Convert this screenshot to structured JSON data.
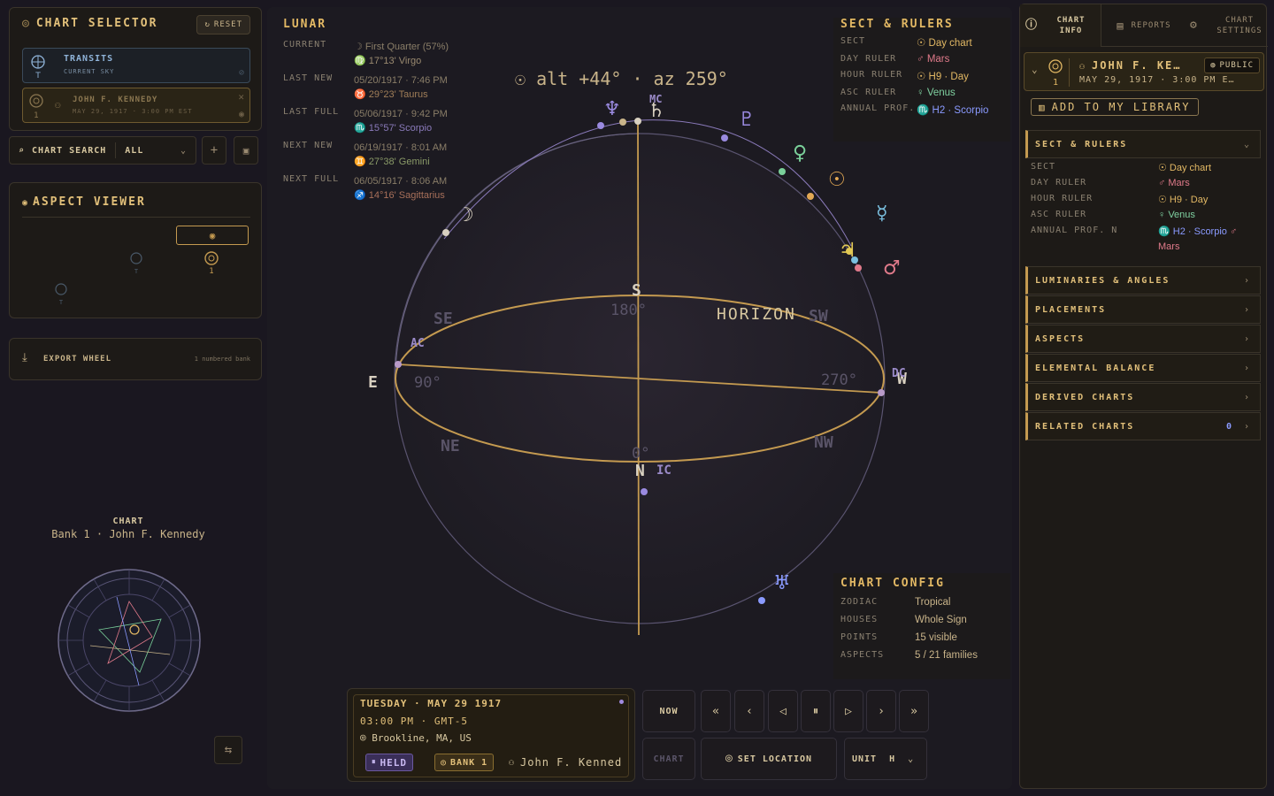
{
  "chart_selector": {
    "title": "CHART SELECTOR",
    "reset": "RESET",
    "transits": {
      "label": "TRANSITS",
      "sub": "CURRENT SKY"
    },
    "bank": {
      "number": "1",
      "label": "JOHN F. KENNEDY",
      "sub": "MAY 29, 1917 · 3:00 PM EST"
    }
  },
  "search": {
    "label": "CHART SEARCH",
    "filter": "ALL"
  },
  "aspect_viewer": {
    "title": "ASPECT VIEWER",
    "bank_number": "1"
  },
  "export": {
    "label": "EXPORT WHEEL",
    "sub": "1 numbered bank"
  },
  "chart_caption": {
    "title": "CHART",
    "subtitle": "Bank 1 · John F. Kennedy"
  },
  "lunar": {
    "title": "LUNAR",
    "rows": [
      {
        "key": "CURRENT",
        "line1": "First Quarter (57%)",
        "line2": "17°13' Virgo",
        "icon1": "☽",
        "icon2": "♍"
      },
      {
        "key": "LAST NEW",
        "line1": "05/20/1917 · 7:46 PM",
        "line2": "29°23' Taurus",
        "icon2": "♉"
      },
      {
        "key": "LAST FULL",
        "line1": "05/06/1917 · 9:42 PM",
        "line2": "15°57' Scorpio",
        "icon2": "♏"
      },
      {
        "key": "NEXT NEW",
        "line1": "06/19/1917 · 8:01 AM",
        "line2": "27°38' Gemini",
        "icon2": "♊"
      },
      {
        "key": "NEXT FULL",
        "line1": "06/05/1917 · 8:06 AM",
        "line2": "14°16' Sagittarius",
        "icon2": "♐"
      }
    ]
  },
  "sect": {
    "title": "SECT & RULERS",
    "rows": [
      {
        "key": "SECT",
        "value": "Day chart",
        "icon": "☉",
        "color": "#e2b864"
      },
      {
        "key": "DAY RULER",
        "value": "Mars",
        "icon": "♂",
        "color": "#e07a8a"
      },
      {
        "key": "HOUR RULER",
        "value": "H9 · Day",
        "icon": "☉",
        "color": "#e2b864"
      },
      {
        "key": "ASC RULER",
        "value": "Venus",
        "icon": "♀",
        "color": "#7fd0a0"
      },
      {
        "key": "ANNUAL PROF.",
        "value": "H2 · Scorpio",
        "icon": "♏",
        "color": "#8a9aff"
      }
    ]
  },
  "sky": {
    "readout": "☉ alt +44° · az 259°",
    "labels": {
      "horizon": "HORIZON",
      "s": "S",
      "n": "N",
      "e": "E",
      "w": "W",
      "se": "SE",
      "sw": "SW",
      "ne": "NE",
      "nw": "NW",
      "deg180": "180°",
      "deg90": "90°",
      "deg270": "270°",
      "deg0": "0°",
      "mc": "MC",
      "ic": "IC",
      "ac": "AC",
      "dc": "DC"
    }
  },
  "chart_config": {
    "title": "CHART CONFIG",
    "rows": [
      {
        "key": "ZODIAC",
        "value": "Tropical"
      },
      {
        "key": "HOUSES",
        "value": "Whole Sign"
      },
      {
        "key": "POINTS",
        "value": "15 visible"
      },
      {
        "key": "ASPECTS",
        "value": "5 / 21 families"
      }
    ]
  },
  "datetime": {
    "day": "TUESDAY · MAY 29 1917",
    "time": "03:00 PM · GMT-5",
    "location": "Brookline, MA, US",
    "held": "HELD",
    "bank": "BANK 1",
    "person": "John F. Kenned"
  },
  "controls": {
    "now": "NOW",
    "chart": "CHART",
    "set_location": "SET LOCATION",
    "unit": "UNIT",
    "unit_value": "H"
  },
  "right": {
    "tabs": {
      "info": "CHART INFO",
      "reports": "REPORTS",
      "settings": "CHART SETTINGS"
    },
    "profile": {
      "number": "1",
      "name": "JOHN F. KE…",
      "date": "MAY 29, 1917 · 3:00 PM E…",
      "public": "PUBLIC"
    },
    "add_library": "ADD TO MY LIBRARY",
    "sect_rows": [
      {
        "key": "SECT",
        "value": "Day chart",
        "icon": "☉",
        "color": "#e2b864"
      },
      {
        "key": "DAY RULER",
        "value": "Mars",
        "icon": "♂",
        "color": "#e07a8a"
      },
      {
        "key": "HOUR RULER",
        "value": "H9 · Day",
        "icon": "☉",
        "color": "#e2b864"
      },
      {
        "key": "ASC RULER",
        "value": "Venus",
        "icon": "♀",
        "color": "#7fd0a0"
      },
      {
        "key": "ANNUAL PROF. N",
        "value": "H2 · Scorpio",
        "icon": "♏",
        "color": "#8a9aff",
        "extra": "Mars"
      }
    ],
    "sections": [
      {
        "label": "SECT & RULERS",
        "chev": "⌄"
      },
      {
        "label": "LUMINARIES & ANGLES",
        "chev": "›"
      },
      {
        "label": "PLACEMENTS",
        "chev": "›"
      },
      {
        "label": "ASPECTS",
        "chev": "›"
      },
      {
        "label": "ELEMENTAL BALANCE",
        "chev": "›"
      },
      {
        "label": "DERIVED CHARTS",
        "chev": "›"
      },
      {
        "label": "RELATED CHARTS",
        "chev": "›",
        "count": "0"
      }
    ]
  }
}
